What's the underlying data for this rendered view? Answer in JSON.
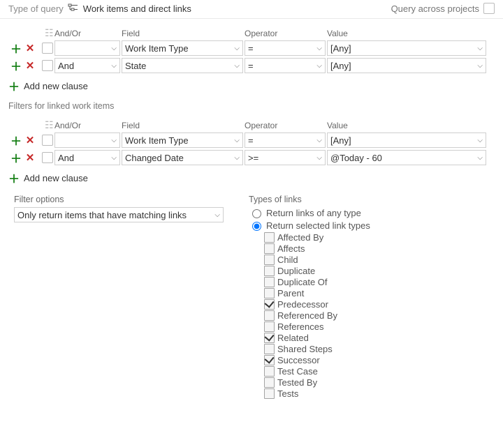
{
  "topbar": {
    "query_type_label": "Type of query",
    "query_type_value": "Work items and direct links",
    "cross_projects_label": "Query across projects",
    "cross_projects_checked": false
  },
  "header": {
    "andor": "And/Or",
    "field": "Field",
    "operator": "Operator",
    "value": "Value"
  },
  "top_clauses": [
    {
      "andor": "",
      "andor_empty": true,
      "field": "Work Item Type",
      "operator": "=",
      "value": "[Any]"
    },
    {
      "andor": "And",
      "andor_empty": false,
      "field": "State",
      "operator": "=",
      "value": "[Any]"
    }
  ],
  "add_clause_label": "Add new clause",
  "linked_section_label": "Filters for linked work items",
  "linked_clauses": [
    {
      "andor": "",
      "andor_empty": true,
      "field": "Work Item Type",
      "operator": "=",
      "value": "[Any]"
    },
    {
      "andor": "And",
      "andor_empty": false,
      "field": "Changed Date",
      "operator": ">=",
      "value": "@Today - 60"
    }
  ],
  "filter_options": {
    "label": "Filter options",
    "value": "Only return items that have matching links"
  },
  "types_of_links": {
    "label": "Types of links",
    "options": {
      "any": "Return links of any type",
      "selected": "Return selected link types"
    },
    "choice": "selected"
  },
  "link_types": [
    {
      "label": "Affected By",
      "checked": false
    },
    {
      "label": "Affects",
      "checked": false
    },
    {
      "label": "Child",
      "checked": false
    },
    {
      "label": "Duplicate",
      "checked": false
    },
    {
      "label": "Duplicate Of",
      "checked": false
    },
    {
      "label": "Parent",
      "checked": false
    },
    {
      "label": "Predecessor",
      "checked": true
    },
    {
      "label": "Referenced By",
      "checked": false
    },
    {
      "label": "References",
      "checked": false
    },
    {
      "label": "Related",
      "checked": true
    },
    {
      "label": "Shared Steps",
      "checked": false
    },
    {
      "label": "Successor",
      "checked": true
    },
    {
      "label": "Test Case",
      "checked": false
    },
    {
      "label": "Tested By",
      "checked": false
    },
    {
      "label": "Tests",
      "checked": false
    }
  ]
}
